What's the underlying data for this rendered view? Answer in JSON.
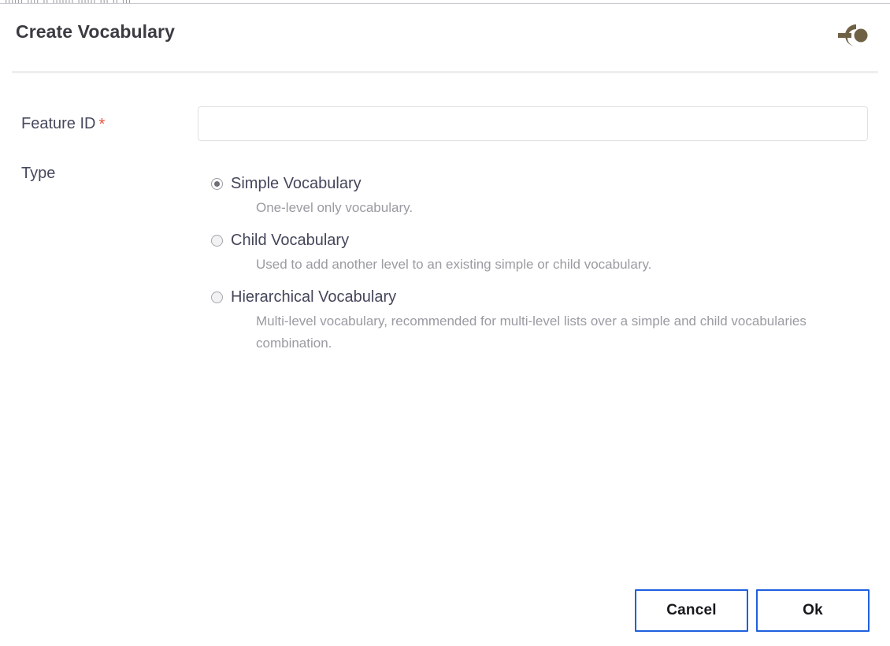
{
  "window": {
    "clipped_top_text": "|||||| |||| || ||||||| |||||| ||| || |||"
  },
  "dialog": {
    "title": "Create Vocabulary",
    "header_icon": "pin-icon"
  },
  "form": {
    "feature_id": {
      "label": "Feature ID",
      "required_marker": "*",
      "value": "",
      "placeholder": ""
    },
    "type": {
      "label": "Type",
      "selected": "simple",
      "options": [
        {
          "id": "simple",
          "label": "Simple Vocabulary",
          "description": "One-level only vocabulary.",
          "checked": true
        },
        {
          "id": "child",
          "label": "Child Vocabulary",
          "description": "Used to add another level to an existing simple or child vocabulary.",
          "checked": false
        },
        {
          "id": "hierarchical",
          "label": "Hierarchical Vocabulary",
          "description": "Multi-level vocabulary, recommended for multi-level lists over a simple and child vocabularies combination.",
          "checked": false
        }
      ]
    }
  },
  "footer": {
    "cancel_label": "Cancel",
    "ok_label": "Ok"
  },
  "colors": {
    "accent_blue": "#1f60e0",
    "required_red": "#e8523c",
    "label_text": "#46485c",
    "description_text": "#9a9aa2",
    "title_text": "#3b3b42",
    "header_icon": "#6f6244",
    "input_border": "#e0e0e0",
    "divider": "#eeeeef"
  }
}
